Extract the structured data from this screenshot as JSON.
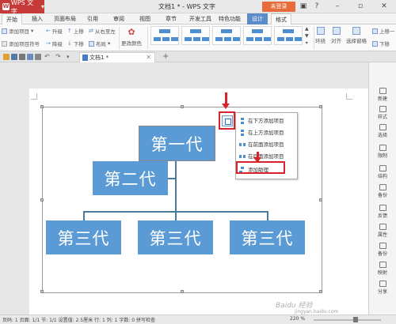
{
  "app": {
    "menu_label": "WPS 文字",
    "window_title": "文档1 * - WPS 文字",
    "login_label": "未登录"
  },
  "menus": [
    "开始",
    "插入",
    "页面布局",
    "引用",
    "审阅",
    "视图",
    "章节",
    "开发工具",
    "特色功能",
    "设计",
    "格式"
  ],
  "ribbon": {
    "add_item": "添加项目",
    "add_bullet": "添加项目符号",
    "promote": "升级",
    "demote": "降级",
    "move_up": "上移",
    "move_down": "下移",
    "right_to_left": "从右至左",
    "layout": "布局",
    "change_color": "更改颜色",
    "wrap": "环绕",
    "align": "对齐",
    "select_pane": "选择窗格",
    "up_one": "上移一",
    "down_one": "下移"
  },
  "tab": {
    "doc_name": "文档1 *"
  },
  "smartart": {
    "gen1": "第一代",
    "gen2": "第二代",
    "gen3": [
      "第三代",
      "第三代",
      "第三代"
    ]
  },
  "dropdown": {
    "items": [
      "在下方添加项目",
      "在上方添加项目",
      "在前面添加项目",
      "在后面添加项目",
      "添加助理"
    ]
  },
  "sidebar": [
    "新建",
    "样式",
    "选择",
    "限制",
    "结构",
    "备份",
    "反馈",
    "属性",
    "备份",
    "映射",
    "分享"
  ],
  "status": {
    "text": "页码: 1  页面: 1/1  节: 1/1  设置值: 2.5厘米  行: 1  列: 1  字数: 0  拼写检查",
    "zoom": "220 %"
  },
  "watermark": "Baidu 经验",
  "watermark_url": "jingyan.baidu.com",
  "colors": {
    "accent": "#5b9bd5",
    "highlight": "#d9232a",
    "app_red": "#c73a3a"
  }
}
